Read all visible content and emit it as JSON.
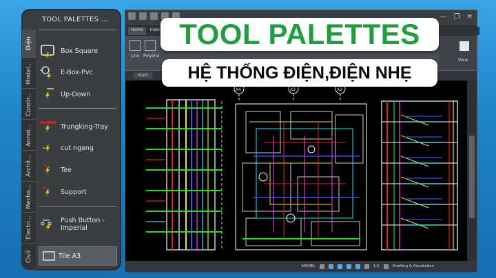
{
  "palette": {
    "title": "TOOL PALETTES ...",
    "tabs": [
      {
        "label": "Điện",
        "active": true
      },
      {
        "label": "Model...",
        "active": false
      },
      {
        "label": "Constr...",
        "active": false
      },
      {
        "label": "Annot...",
        "active": false
      },
      {
        "label": "Archit...",
        "active": false
      },
      {
        "label": "Mecha...",
        "active": false
      },
      {
        "label": "Electri...",
        "active": false
      },
      {
        "label": "Civil",
        "active": false
      }
    ],
    "tools": [
      {
        "label": "Box Square",
        "icon": "box-square-icon"
      },
      {
        "label": "E-Box-Pvc",
        "icon": "ebox-pvc-icon"
      },
      {
        "label": "Up-Down",
        "icon": "up-down-icon"
      },
      {
        "label": "Trungking-Tray",
        "icon": "trunking-tray-icon"
      },
      {
        "label": "cut ngang",
        "icon": "cut-ngang-icon"
      },
      {
        "label": "Tee",
        "icon": "tee-icon"
      },
      {
        "label": "Support",
        "icon": "support-icon"
      },
      {
        "label": "Push Button - Imperial",
        "icon": "push-button-icon"
      },
      {
        "label": "Tile A3",
        "icon": "tile-a3-icon"
      }
    ]
  },
  "banner": {
    "title": "TOOL PALETTES",
    "subtitle": "HỆ THỐNG ĐIỆN,ĐIỆN NHẸ",
    "title_color": "#1e9e3c"
  },
  "autocad": {
    "ribbon_tabs": [
      "Home",
      "Insert"
    ],
    "ribbon_buttons": [
      "Line",
      "Polyline"
    ],
    "doc_tab": "Start",
    "view_label": "View",
    "grid_labels": [
      "X4",
      "X3",
      "X2"
    ],
    "status": {
      "model": "MODEL",
      "scale": "1:1",
      "workspace": "Drafting & Annotation"
    },
    "window_buttons": [
      "—",
      "❐",
      "✕"
    ]
  }
}
